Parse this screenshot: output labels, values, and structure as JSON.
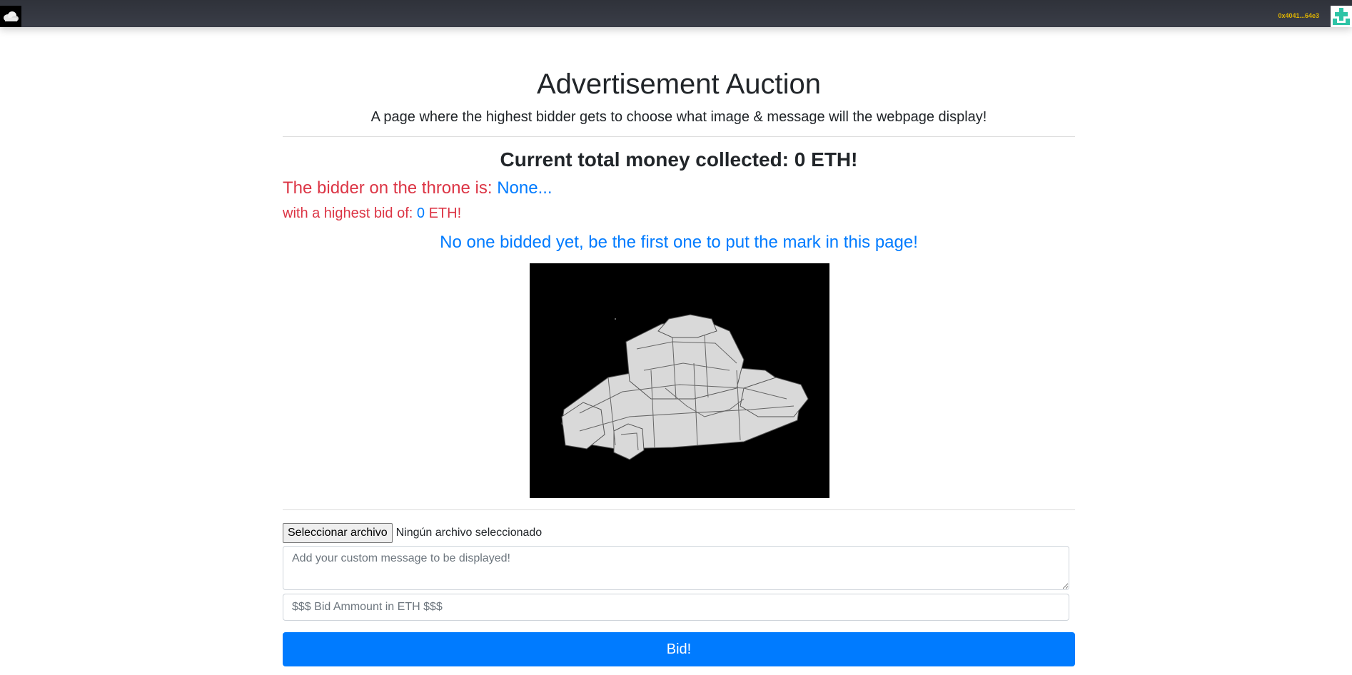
{
  "navbar": {
    "logo_icon": "cloud-logo-icon",
    "account": "0x4041...64e3",
    "avatar_icon": "identicon-avatar-icon"
  },
  "header": {
    "title": "Advertisement Auction",
    "subtitle": "A page where the highest bidder gets to choose what image & message will the webpage display!"
  },
  "status": {
    "total_prefix": "Current total money collected:",
    "total_value": "0",
    "total_suffix": "ETH!",
    "throne_label": "The bidder on the throne is:",
    "throne_value": "None...",
    "highest_bid_label": "with a highest bid of:",
    "highest_bid_value": "0",
    "highest_bid_unit": "ETH!",
    "no_bid_message": "No one bidded yet, be the first one to put the mark in this page!"
  },
  "ad": {
    "image_icon": "spaceship-wireframe-image"
  },
  "form": {
    "file_button": "Seleccionar archivo",
    "file_status": "Ningún archivo seleccionado",
    "message_placeholder": "Add your custom message to be displayed!",
    "bid_placeholder": "$$$ Bid Ammount in ETH $$$",
    "submit_label": "Bid!"
  },
  "colors": {
    "navbar": "#2f323a",
    "danger": "#dc3545",
    "primary": "#007bff",
    "account": "#e0b400"
  }
}
